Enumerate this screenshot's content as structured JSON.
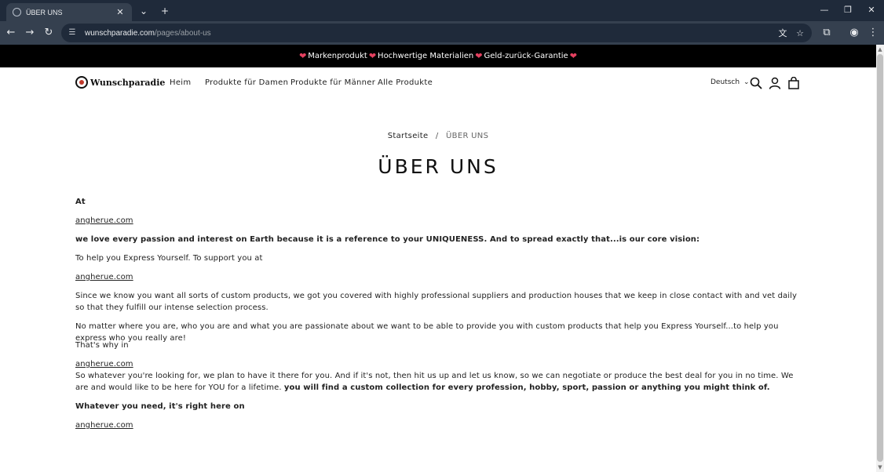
{
  "browser": {
    "tab_title": "ÜBER UNS",
    "url_host": "wunschparadie.com",
    "url_path": "/pages/about-us",
    "icons": [
      "back-icon",
      "forward-icon",
      "reload-icon",
      "site-info-icon",
      "translate-icon",
      "star-icon",
      "extensions-icon",
      "profile-icon",
      "menu-icon",
      "tab-search-icon",
      "new-tab-icon",
      "minimize-icon",
      "restore-icon",
      "close-icon"
    ]
  },
  "announcement": {
    "items": [
      "Markenprodukt",
      "Hochwertige Materialien",
      "Geld-zurück-Garantie"
    ],
    "heart": "❤"
  },
  "header": {
    "logo_text": "Wunschparadie",
    "menu": [
      "Heim",
      "Produkte für Damen",
      "Produkte für Männer",
      "Alle Produkte"
    ],
    "language": "Deutsch"
  },
  "breadcrumb": {
    "home": "Startseite",
    "separator": "/",
    "current": "ÜBER UNS"
  },
  "page_title": "ÜBER UNS",
  "content": {
    "p1": "At",
    "link1": "angherue.com",
    "p2": " we love every passion and interest on Earth because it is a reference to your UNIQUENESS. And to spread exactly that...is our core vision:",
    "p3": "To help you Express Yourself. To support you at",
    "link2": "angherue.com",
    "p4": "Since we know you want all sorts of custom products, we got you covered with highly professional suppliers and production houses that we keep in close contact with and vet daily so that they fulfill our intense selection process.",
    "p5": "No matter where you are, who you are and what you are passionate about we want to be able to provide you with custom products that help you Express Yourself...to help you express who you really are!",
    "p6": "That's why in",
    "link3": "angherue.com",
    "p7_normal": "So whatever you're looking for, we plan to have it there for you. And if it's not, then hit us up and let us know, so we can negotiate or produce the best deal for you in no time. We are and would like to be here for YOU for a lifetime. ",
    "p7_bold": "you will find a custom collection for every profession, hobby, sport, passion or anything you might think of.",
    "p8": "Whatever you need, it's right here on",
    "link4": "angherue.com"
  }
}
